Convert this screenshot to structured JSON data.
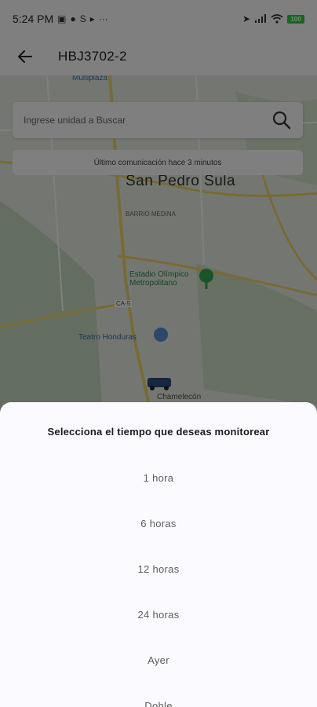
{
  "status_bar": {
    "time": "5:24 PM",
    "icons_left": [
      "photo-icon",
      "chat-icon",
      "skype-icon",
      "play-icon",
      "more-dots-icon"
    ],
    "icons_right": [
      "location-arrow-icon",
      "signal-icon",
      "wifi-icon",
      "battery-icon"
    ],
    "battery_level": "100"
  },
  "app_bar": {
    "title": "HBJ3702-2"
  },
  "map": {
    "city_label": "San Pedro Sula",
    "place_top": "Multiplaza",
    "place_barrio": "BARRIO MEDINA",
    "place_stadium": "Estadio Olímpico Metropolitano",
    "place_teatro": "Teatro Honduras",
    "place_chamelecon": "Chamelecón",
    "route_1": "CA-5"
  },
  "search": {
    "placeholder": "Ingrese unidad a Buscar"
  },
  "communication": {
    "text": "Último comunicación hace 3 minutos"
  },
  "sheet": {
    "title": "Selecciona el tiempo que deseas monitorear",
    "options": [
      "1 hora",
      "6 horas",
      "12 horas",
      "24 horas",
      "Ayer",
      "Doble"
    ]
  },
  "colors": {
    "overlay": "#000000",
    "sheet_bg": "#fbfaff",
    "map_bg": "#e8efe2",
    "road_yellow": "#f2d46b",
    "park_green": "#34a853"
  }
}
